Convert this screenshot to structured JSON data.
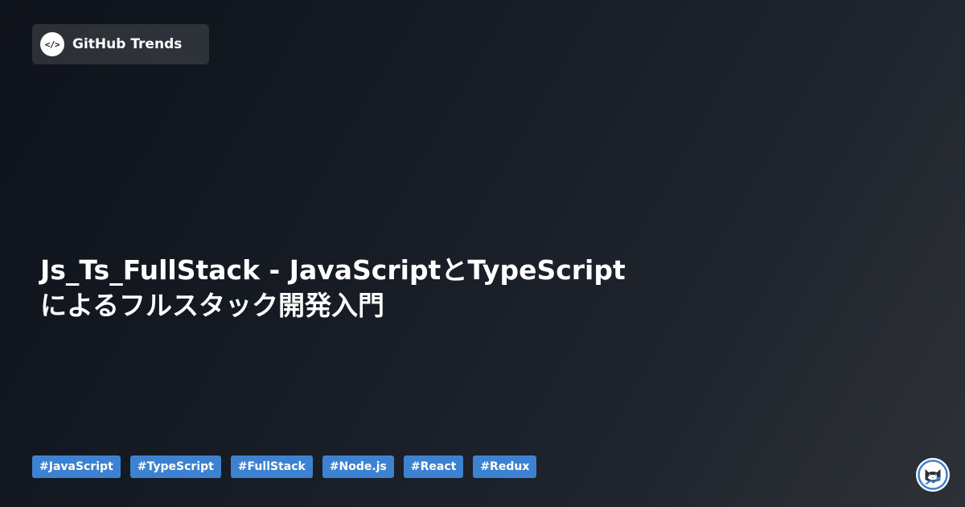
{
  "brand": {
    "icon": "code-brackets-icon",
    "icon_text": "</>",
    "name": "GitHub Trends"
  },
  "title": {
    "line1": "Js_Ts_FullStack - JavaScriptとTypeScript",
    "line2": "によるフルスタック開発入門"
  },
  "tags": [
    "#JavaScript",
    "#TypeScript",
    "#FullStack",
    "#Node.js",
    "#React",
    "#Redux"
  ],
  "mascot": {
    "icon": "cat-mascot-icon"
  },
  "colors": {
    "tag_background": "#3d82d0",
    "mascot_ring": "#3d82d0",
    "background_dark": "#0f131b",
    "background_light": "#2e3137"
  }
}
